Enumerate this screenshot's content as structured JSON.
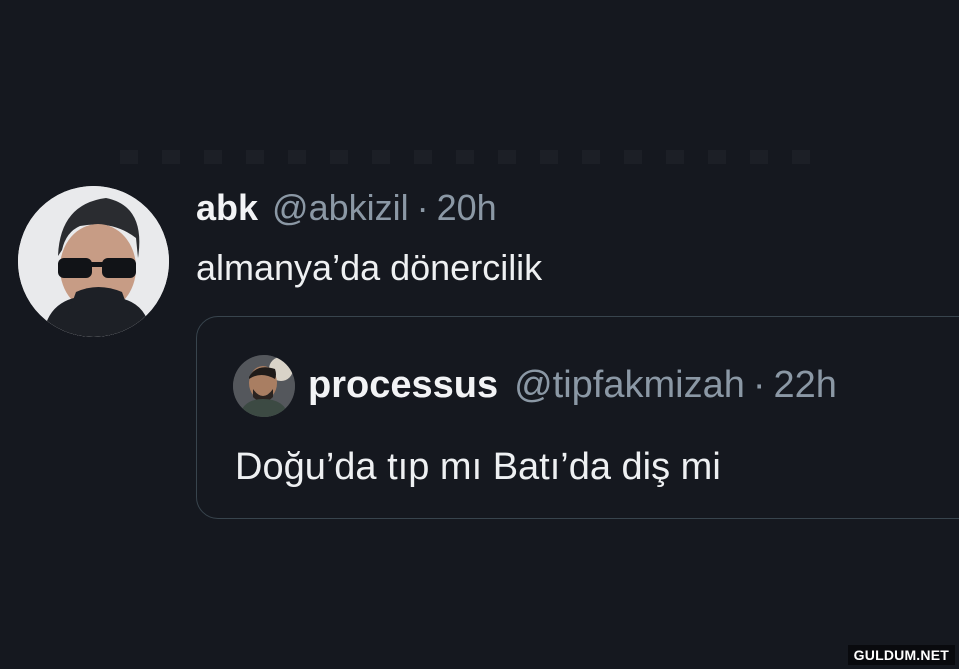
{
  "tweet": {
    "author_name": "abk",
    "author_handle": "@abkizil",
    "separator": "·",
    "time": "20h",
    "text": "almanya’da dönercilik",
    "avatar_icon": "user-avatar-icon"
  },
  "quoted_tweet": {
    "author_name": "processus",
    "author_handle": "@tipfakmizah",
    "separator": "·",
    "time": "22h",
    "text": "Doğu’da tıp mı Batı’da diş mi",
    "avatar_icon": "user-avatar-icon"
  },
  "watermark": {
    "text": "GULDUM.NET"
  },
  "colors": {
    "background": "#15181f",
    "primary_text": "#eef0f2",
    "secondary_text": "#8b98a5",
    "border": "#38444d"
  }
}
